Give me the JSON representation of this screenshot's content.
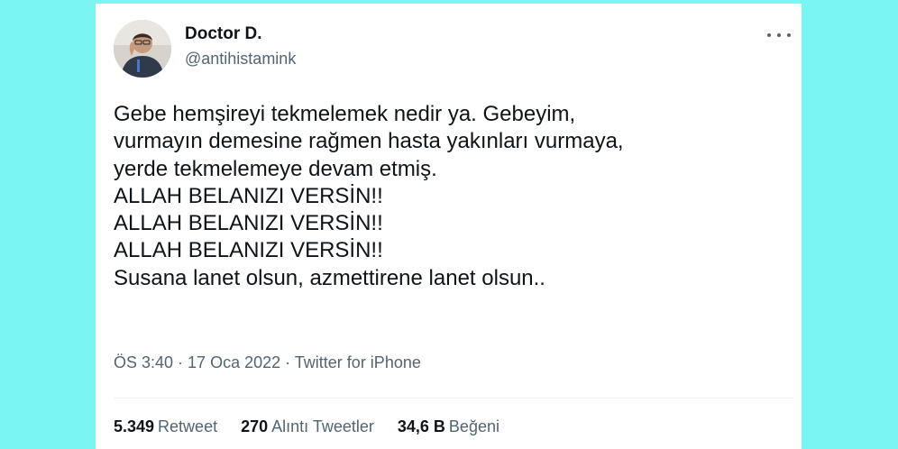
{
  "tweet": {
    "author": {
      "display_name": "Doctor D.",
      "handle": "@antihistamink"
    },
    "more_icon": "more-horizontal-icon",
    "text_lines": [
      "Gebe hemşireyi tekmelemek nedir ya. Gebeyim,",
      "vurmayın demesine rağmen hasta yakınları vurmaya,",
      "yerde tekmelemeye devam etmiş.",
      "ALLAH BELANIZI VERSİN!!",
      "ALLAH BELANIZI VERSİN!!",
      "ALLAH BELANIZI VERSİN!!",
      "Susana lanet olsun, azmettirene lanet olsun.."
    ],
    "meta": {
      "time": "ÖS 3:40",
      "separator": " · ",
      "date": "17 Oca 2022",
      "source": "Twitter for iPhone"
    },
    "stats": {
      "retweets": {
        "count": "5.349",
        "label": "Retweet"
      },
      "quotes": {
        "count": "270",
        "label": "Alıntı Tweetler"
      },
      "likes": {
        "count": "34,6 B",
        "label": "Beğeni"
      }
    }
  },
  "colors": {
    "background": "#7af5f4",
    "card": "#ffffff",
    "text_primary": "#0f1419",
    "text_secondary": "#536471",
    "divider": "#eff3f4"
  }
}
